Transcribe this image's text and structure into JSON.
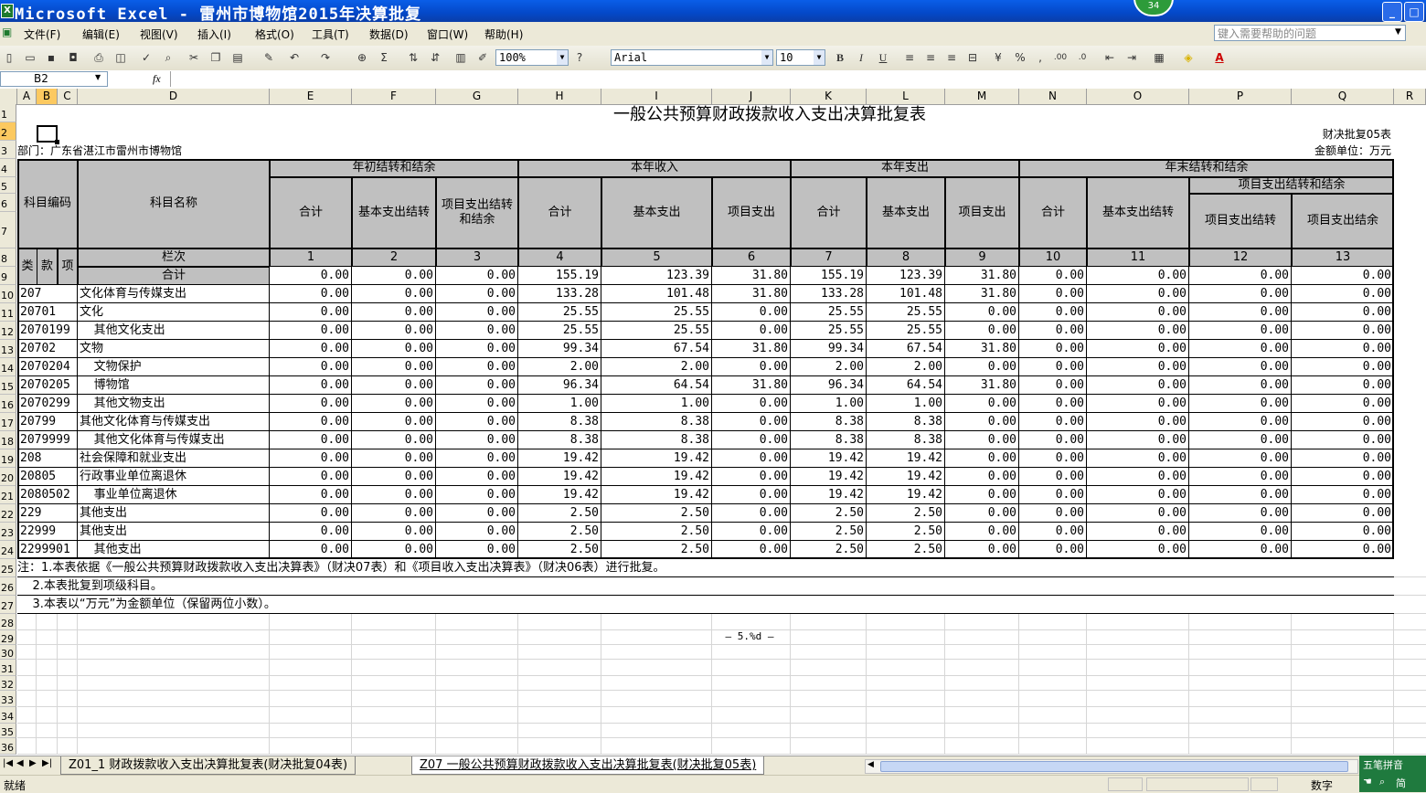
{
  "window": {
    "title": "Microsoft Excel - 雷州市博物馆2015年决算批复",
    "badge": "34"
  },
  "menu": {
    "items": [
      "文件(F)",
      "编辑(E)",
      "视图(V)",
      "插入(I)",
      "格式(O)",
      "工具(T)",
      "数据(D)",
      "窗口(W)",
      "帮助(H)"
    ],
    "help_placeholder": "键入需要帮助的问题"
  },
  "toolbar": {
    "zoom": "100%",
    "font": "Arial",
    "size": "10"
  },
  "formula": {
    "namebox": "B2",
    "fx": "fx",
    "content": ""
  },
  "columns": [
    "A",
    "B",
    "C",
    "D",
    "E",
    "F",
    "G",
    "H",
    "I",
    "J",
    "K",
    "L",
    "M",
    "N",
    "O",
    "P",
    "Q",
    "R"
  ],
  "rows": [
    "1",
    "2",
    "3",
    "4",
    "5",
    "6",
    "7",
    "8",
    "9",
    "10",
    "11",
    "12",
    "13",
    "14",
    "15",
    "16",
    "17",
    "18",
    "19",
    "20",
    "21",
    "22",
    "23",
    "24",
    "25",
    "26",
    "27",
    "28",
    "29",
    "30",
    "31",
    "32",
    "33",
    "34",
    "35",
    "36"
  ],
  "sheet": {
    "title": "一般公共预算财政拨款收入支出决算批复表",
    "form_no": "财决批复05表",
    "dept": "部门：广东省湛江市雷州市博物馆",
    "unit": "金额单位：万元",
    "hdr": {
      "code": "科目编码",
      "name": "科目名称",
      "lanci": "栏次",
      "lei": "类",
      "kuan": "款",
      "xiang": "项",
      "g1": "年初结转和结余",
      "g2": "本年收入",
      "g3": "本年支出",
      "g4": "年末结转和结余",
      "g4sub": "项目支出结转和结余",
      "sub": [
        "合计",
        "基本支出结转",
        "项目支出结转和结余",
        "合计",
        "基本支出",
        "项目支出",
        "合计",
        "基本支出",
        "项目支出",
        "合计",
        "基本支出结转",
        "项目支出结转",
        "项目支出结余"
      ],
      "nums": [
        "1",
        "2",
        "3",
        "4",
        "5",
        "6",
        "7",
        "8",
        "9",
        "10",
        "11",
        "12",
        "13"
      ]
    },
    "total": {
      "name": "合计",
      "v": [
        "0.00",
        "0.00",
        "0.00",
        "155.19",
        "123.39",
        "31.80",
        "155.19",
        "123.39",
        "31.80",
        "0.00",
        "0.00",
        "0.00",
        "0.00"
      ]
    },
    "data": [
      {
        "code": "207",
        "name": "文化体育与传媒支出",
        "v": [
          "0.00",
          "0.00",
          "0.00",
          "133.28",
          "101.48",
          "31.80",
          "133.28",
          "101.48",
          "31.80",
          "0.00",
          "0.00",
          "0.00",
          "0.00"
        ]
      },
      {
        "code": "20701",
        "name": "文化",
        "v": [
          "0.00",
          "0.00",
          "0.00",
          "25.55",
          "25.55",
          "0.00",
          "25.55",
          "25.55",
          "0.00",
          "0.00",
          "0.00",
          "0.00",
          "0.00"
        ]
      },
      {
        "code": "2070199",
        "name": "  其他文化支出",
        "v": [
          "0.00",
          "0.00",
          "0.00",
          "25.55",
          "25.55",
          "0.00",
          "25.55",
          "25.55",
          "0.00",
          "0.00",
          "0.00",
          "0.00",
          "0.00"
        ]
      },
      {
        "code": "20702",
        "name": "文物",
        "v": [
          "0.00",
          "0.00",
          "0.00",
          "99.34",
          "67.54",
          "31.80",
          "99.34",
          "67.54",
          "31.80",
          "0.00",
          "0.00",
          "0.00",
          "0.00"
        ]
      },
      {
        "code": "2070204",
        "name": "  文物保护",
        "v": [
          "0.00",
          "0.00",
          "0.00",
          "2.00",
          "2.00",
          "0.00",
          "2.00",
          "2.00",
          "0.00",
          "0.00",
          "0.00",
          "0.00",
          "0.00"
        ]
      },
      {
        "code": "2070205",
        "name": "  博物馆",
        "v": [
          "0.00",
          "0.00",
          "0.00",
          "96.34",
          "64.54",
          "31.80",
          "96.34",
          "64.54",
          "31.80",
          "0.00",
          "0.00",
          "0.00",
          "0.00"
        ]
      },
      {
        "code": "2070299",
        "name": "  其他文物支出",
        "v": [
          "0.00",
          "0.00",
          "0.00",
          "1.00",
          "1.00",
          "0.00",
          "1.00",
          "1.00",
          "0.00",
          "0.00",
          "0.00",
          "0.00",
          "0.00"
        ]
      },
      {
        "code": "20799",
        "name": "其他文化体育与传媒支出",
        "v": [
          "0.00",
          "0.00",
          "0.00",
          "8.38",
          "8.38",
          "0.00",
          "8.38",
          "8.38",
          "0.00",
          "0.00",
          "0.00",
          "0.00",
          "0.00"
        ]
      },
      {
        "code": "2079999",
        "name": "  其他文化体育与传媒支出",
        "v": [
          "0.00",
          "0.00",
          "0.00",
          "8.38",
          "8.38",
          "0.00",
          "8.38",
          "8.38",
          "0.00",
          "0.00",
          "0.00",
          "0.00",
          "0.00"
        ]
      },
      {
        "code": "208",
        "name": "社会保障和就业支出",
        "v": [
          "0.00",
          "0.00",
          "0.00",
          "19.42",
          "19.42",
          "0.00",
          "19.42",
          "19.42",
          "0.00",
          "0.00",
          "0.00",
          "0.00",
          "0.00"
        ]
      },
      {
        "code": "20805",
        "name": "行政事业单位离退休",
        "v": [
          "0.00",
          "0.00",
          "0.00",
          "19.42",
          "19.42",
          "0.00",
          "19.42",
          "19.42",
          "0.00",
          "0.00",
          "0.00",
          "0.00",
          "0.00"
        ]
      },
      {
        "code": "2080502",
        "name": "  事业单位离退休",
        "v": [
          "0.00",
          "0.00",
          "0.00",
          "19.42",
          "19.42",
          "0.00",
          "19.42",
          "19.42",
          "0.00",
          "0.00",
          "0.00",
          "0.00",
          "0.00"
        ]
      },
      {
        "code": "229",
        "name": "其他支出",
        "v": [
          "0.00",
          "0.00",
          "0.00",
          "2.50",
          "2.50",
          "0.00",
          "2.50",
          "2.50",
          "0.00",
          "0.00",
          "0.00",
          "0.00",
          "0.00"
        ]
      },
      {
        "code": "22999",
        "name": "其他支出",
        "v": [
          "0.00",
          "0.00",
          "0.00",
          "2.50",
          "2.50",
          "0.00",
          "2.50",
          "2.50",
          "0.00",
          "0.00",
          "0.00",
          "0.00",
          "0.00"
        ]
      },
      {
        "code": "2299901",
        "name": "  其他支出",
        "v": [
          "0.00",
          "0.00",
          "0.00",
          "2.50",
          "2.50",
          "0.00",
          "2.50",
          "2.50",
          "0.00",
          "0.00",
          "0.00",
          "0.00",
          "0.00"
        ]
      }
    ],
    "notes": [
      "注：1.本表依据《一般公共预算财政拨款收入支出决算表》（财决07表）和《项目收入支出决算表》（财决06表）进行批复。",
      "    2.本表批复到项级科目。",
      "    3.本表以“万元”为金额单位（保留两位小数）。"
    ],
    "page_footer": "— 5.%d —"
  },
  "tabs": [
    "Z01_1 财政拨款收入支出决算批复表(财决批复04表)",
    "Z07 一般公共预算财政拨款收入支出决算批复表(财决批复05表)"
  ],
  "status": {
    "left": "就绪",
    "mode": "数字"
  },
  "ime": {
    "name": "五笔拼音",
    "mode": "简"
  }
}
